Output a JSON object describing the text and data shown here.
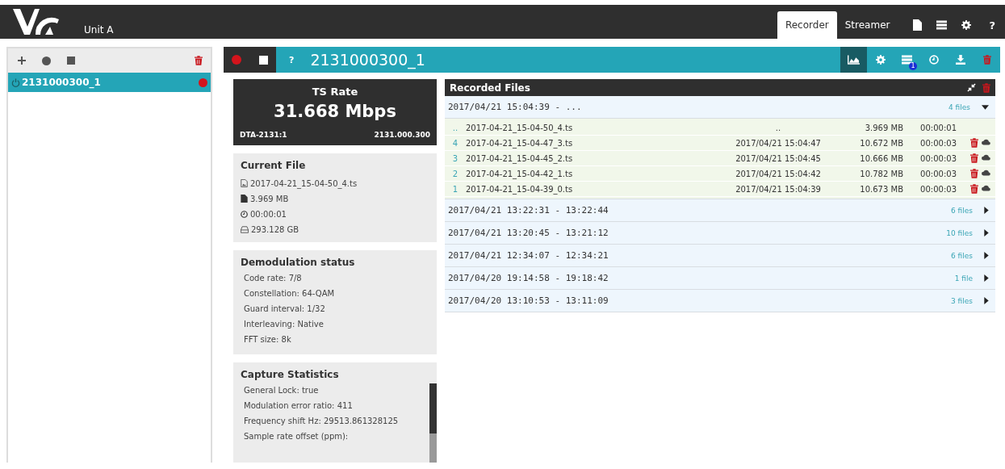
{
  "header": {
    "unit": "Unit A",
    "tabs": [
      {
        "label": "Recorder",
        "selected": true
      },
      {
        "label": "Streamer",
        "selected": false
      }
    ],
    "badge_icons": [
      {
        "kind": "document"
      },
      {
        "kind": "list"
      },
      {
        "kind": "gear"
      },
      {
        "kind": "help",
        "label": "?"
      }
    ]
  },
  "sidebar": {
    "items": [
      {
        "label": "2131000300_1",
        "selected": true,
        "recording": true
      }
    ]
  },
  "main": {
    "title": "2131000300_1",
    "help": "?",
    "tools": [
      {
        "kind": "chart",
        "selected": true
      },
      {
        "kind": "gear",
        "selected": false
      },
      {
        "kind": "list",
        "selected": false,
        "badge": "1"
      },
      {
        "kind": "clock",
        "selected": false
      },
      {
        "kind": "download",
        "selected": false
      },
      {
        "kind": "trash",
        "selected": false
      }
    ],
    "ts_rate": {
      "title": "TS Rate",
      "value": "31.668 Mbps",
      "device": "DTA-2131:1",
      "serial": "2131.000.300"
    },
    "current_file": {
      "title": "Current File",
      "lines": [
        {
          "kind": "file",
          "text": "2017-04-21_15-04-50_4.ts"
        },
        {
          "kind": "size",
          "text": "3.969 MB"
        },
        {
          "kind": "clock",
          "text": "00:00:01"
        },
        {
          "kind": "disk",
          "text": "293.128 GB"
        }
      ]
    },
    "demodulation": {
      "title": "Demodulation status",
      "lines": [
        "Code rate: 7/8",
        "Constellation: 64-QAM",
        "Guard interval: 1/32",
        "Interleaving: Native",
        "FFT size: 8k"
      ]
    },
    "capture": {
      "title": "Capture Statistics",
      "lines": [
        "General Lock: true",
        "Modulation error ratio: 411",
        "Frequency shift Hz: 29513.861328125",
        "Sample rate offset (ppm):"
      ]
    },
    "recorded": {
      "title": "Recorded Files",
      "groups": [
        {
          "range": "2017/04/21 15:04:39 - ...",
          "count": "4 files",
          "expanded": true,
          "files": [
            {
              "index": "..",
              "name": "2017-04-21_15-04-50_4.ts",
              "created": "..",
              "size": "3.969 MB",
              "duration": "00:00:01",
              "actions": false
            },
            {
              "index": "4",
              "name": "2017-04-21_15-04-47_3.ts",
              "created": "2017/04/21 15:04:47",
              "size": "10.672 MB",
              "duration": "00:00:03",
              "actions": true
            },
            {
              "index": "3",
              "name": "2017-04-21_15-04-45_2.ts",
              "created": "2017/04/21 15:04:45",
              "size": "10.666 MB",
              "duration": "00:00:03",
              "actions": true
            },
            {
              "index": "2",
              "name": "2017-04-21_15-04-42_1.ts",
              "created": "2017/04/21 15:04:42",
              "size": "10.782 MB",
              "duration": "00:00:03",
              "actions": true
            },
            {
              "index": "1",
              "name": "2017-04-21_15-04-39_0.ts",
              "created": "2017/04/21 15:04:39",
              "size": "10.673 MB",
              "duration": "00:00:03",
              "actions": true
            }
          ]
        },
        {
          "range": "2017/04/21 13:22:31 - 13:22:44",
          "count": "6 files",
          "expanded": false
        },
        {
          "range": "2017/04/21 13:20:45 - 13:21:12",
          "count": "10 files",
          "expanded": false
        },
        {
          "range": "2017/04/21 12:34:07 - 12:34:21",
          "count": "6 files",
          "expanded": false
        },
        {
          "range": "2017/04/20 19:14:58 - 19:18:42",
          "count": "1 file",
          "expanded": false
        },
        {
          "range": "2017/04/20 13:10:53 - 13:11:09",
          "count": "3 files",
          "expanded": false
        }
      ]
    }
  }
}
